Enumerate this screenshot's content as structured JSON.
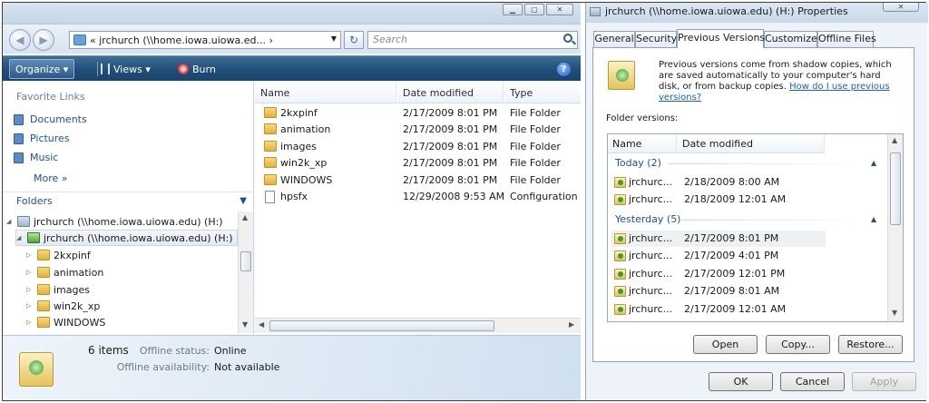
{
  "explorer": {
    "address": "« jrchurch (\\\\home.iowa.uiowa.ed... ›",
    "search_placeholder": "Search",
    "toolbar": {
      "organize": "Organize ▾",
      "views": "Views ▾",
      "burn": "Burn"
    },
    "favorites": {
      "heading": "Favorite Links",
      "items": [
        "Documents",
        "Pictures",
        "Music"
      ],
      "more": "More »"
    },
    "folders_label": "Folders",
    "tree": [
      {
        "label": "jrchurch (\\\\home.iowa.uiowa.edu) (H:)",
        "icon": "network-drive-icon",
        "selected": false
      },
      {
        "label": "jrchurch (\\\\home.iowa.uiowa.edu) (H:)",
        "icon": "drive-icon",
        "selected": true
      },
      {
        "label": "2kxpinf",
        "icon": "folder-icon",
        "selected": false
      },
      {
        "label": "animation",
        "icon": "folder-icon",
        "selected": false
      },
      {
        "label": "images",
        "icon": "folder-icon",
        "selected": false
      },
      {
        "label": "win2k_xp",
        "icon": "folder-icon",
        "selected": false
      },
      {
        "label": "WINDOWS",
        "icon": "folder-icon",
        "selected": false
      }
    ],
    "columns": [
      "Name",
      "Date modified",
      "Type"
    ],
    "files": [
      {
        "name": "2kxpinf",
        "date": "2/17/2009 8:01 PM",
        "type": "File Folder",
        "kind": "folder"
      },
      {
        "name": "animation",
        "date": "2/17/2009 8:01 PM",
        "type": "File Folder",
        "kind": "folder"
      },
      {
        "name": "images",
        "date": "2/17/2009 8:01 PM",
        "type": "File Folder",
        "kind": "folder"
      },
      {
        "name": "win2k_xp",
        "date": "2/17/2009 8:01 PM",
        "type": "File Folder",
        "kind": "folder"
      },
      {
        "name": "WINDOWS",
        "date": "2/17/2009 8:01 PM",
        "type": "File Folder",
        "kind": "folder"
      },
      {
        "name": "hpsfx",
        "date": "12/29/2008 9:53 AM",
        "type": "Configuration S",
        "kind": "file"
      }
    ],
    "details": {
      "count": "6 items",
      "offline_status_label": "Offline status:",
      "offline_status_value": "Online",
      "offline_availability_label": "Offline availability:",
      "offline_availability_value": "Not available"
    }
  },
  "properties": {
    "title": "jrchurch (\\\\home.iowa.uiowa.edu) (H:) Properties",
    "tabs": [
      "General",
      "Security",
      "Previous Versions",
      "Customize",
      "Offline Files"
    ],
    "active_tab": "Previous Versions",
    "description": "Previous versions come from shadow copies, which are saved automatically to your computer's hard disk, or from backup copies.",
    "link": "How do I use previous versions?",
    "folder_versions_label": "Folder versions:",
    "columns": [
      "Name",
      "Date modified"
    ],
    "groups": [
      {
        "label": "Today (2)",
        "rows": [
          {
            "name": "jrchurc...",
            "date": "2/18/2009 8:00 AM"
          },
          {
            "name": "jrchurc...",
            "date": "2/18/2009 12:01 AM"
          }
        ]
      },
      {
        "label": "Yesterday (5)",
        "rows": [
          {
            "name": "jrchurc...",
            "date": "2/17/2009 8:01 PM"
          },
          {
            "name": "jrchurc...",
            "date": "2/17/2009 4:01 PM"
          },
          {
            "name": "jrchurc...",
            "date": "2/17/2009 12:01 PM"
          },
          {
            "name": "jrchurc...",
            "date": "2/17/2009 8:01 AM"
          },
          {
            "name": "jrchurc...",
            "date": "2/17/2009 12:01 AM"
          }
        ]
      }
    ],
    "buttons": {
      "open": "Open",
      "copy": "Copy...",
      "restore": "Restore...",
      "ok": "OK",
      "cancel": "Cancel",
      "apply": "Apply"
    }
  }
}
